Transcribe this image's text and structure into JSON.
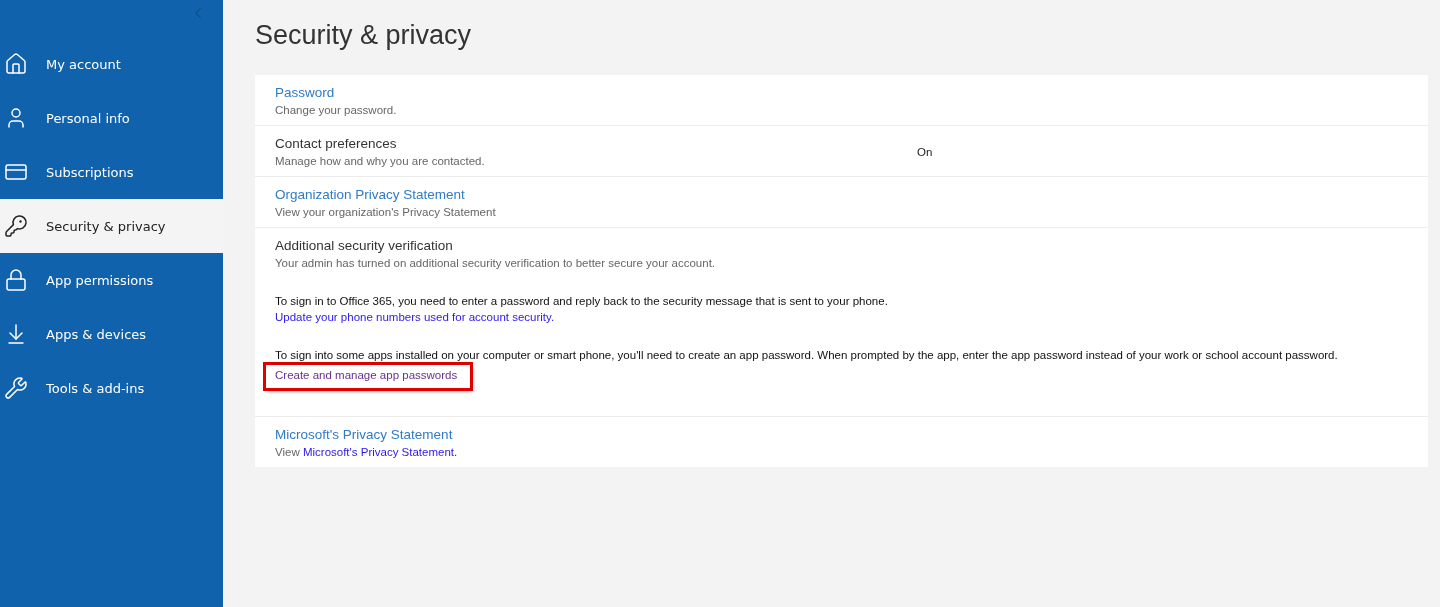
{
  "sidebar": {
    "items": [
      {
        "label": "My account",
        "selected": false
      },
      {
        "label": "Personal info",
        "selected": false
      },
      {
        "label": "Subscriptions",
        "selected": false
      },
      {
        "label": "Security & privacy",
        "selected": true
      },
      {
        "label": "App permissions",
        "selected": false
      },
      {
        "label": "Apps & devices",
        "selected": false
      },
      {
        "label": "Tools & add-ins",
        "selected": false
      }
    ]
  },
  "page": {
    "title": "Security & privacy"
  },
  "sections": [
    {
      "kind": "link",
      "title": "Password",
      "description": "Change your password."
    },
    {
      "kind": "setting",
      "title": "Contact preferences",
      "description": "Manage how and why you are contacted.",
      "value": "On"
    },
    {
      "kind": "link",
      "title": "Organization Privacy Statement",
      "description": "View your organization's Privacy Statement"
    },
    {
      "kind": "details",
      "title": "Additional security verification",
      "description": "Your admin has turned on additional security verification to better secure your account.",
      "paragraphs": [
        {
          "text": "To sign in to Office 365, you need to enter a password and reply back to the security message that is sent to your phone.",
          "link": "Update your phone numbers used for account security.",
          "visited": false,
          "highlighted": false
        },
        {
          "text": "To sign into some apps installed on your computer or smart phone, you'll need to create an app password. When prompted by the app, enter the app password instead of your work or school account password.",
          "link": "Create and manage app passwords",
          "visited": true,
          "highlighted": true
        }
      ]
    },
    {
      "kind": "statement",
      "title": "Microsoft's Privacy Statement",
      "prefix": "View",
      "link": "Microsoft's Privacy Statement."
    }
  ]
}
